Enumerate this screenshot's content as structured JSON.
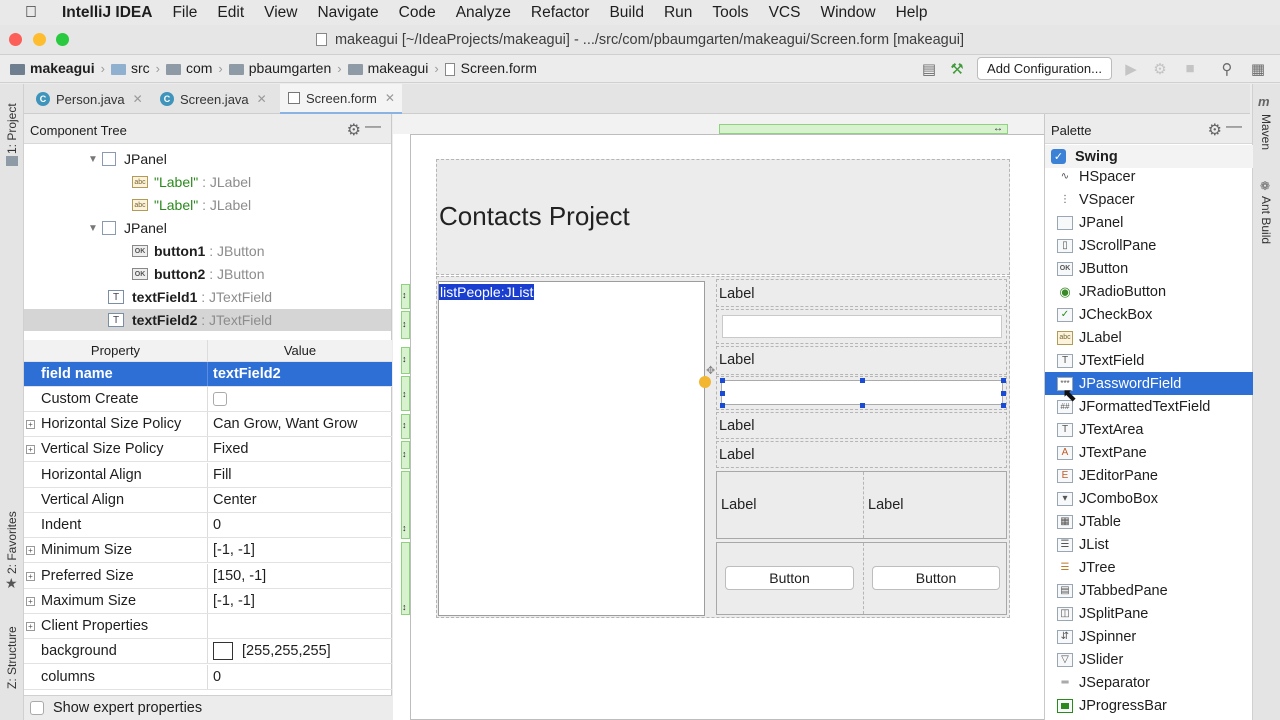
{
  "menubar": {
    "app": "IntelliJ IDEA",
    "items": [
      "File",
      "Edit",
      "View",
      "Navigate",
      "Code",
      "Analyze",
      "Refactor",
      "Build",
      "Run",
      "Tools",
      "VCS",
      "Window",
      "Help"
    ]
  },
  "window": {
    "title": "makeagui [~/IdeaProjects/makeagui] - .../src/com/pbaumgarten/makeagui/Screen.form [makeagui]"
  },
  "breadcrumbs": [
    "makeagui",
    "src",
    "com",
    "pbaumgarten",
    "makeagui",
    "Screen.form"
  ],
  "toolbar": {
    "add_configuration": "Add Configuration..."
  },
  "tabs": [
    {
      "label": "Person.java",
      "icon": "C"
    },
    {
      "label": "Screen.java",
      "icon": "C"
    },
    {
      "label": "Screen.form",
      "icon": "form"
    }
  ],
  "left_strip": {
    "project": "1: Project",
    "favorites": "2: Favorites",
    "structure": "Z: Structure"
  },
  "right_strip": {
    "maven": "Maven",
    "ant": "Ant Build"
  },
  "component_tree": {
    "title": "Component Tree",
    "rows": [
      {
        "kind": "panel",
        "name": "JPanel"
      },
      {
        "kind": "label",
        "text": "\"Label\"",
        "type": ": JLabel"
      },
      {
        "kind": "label",
        "text": "\"Label\"",
        "type": ": JLabel"
      },
      {
        "kind": "panel",
        "name": "JPanel"
      },
      {
        "kind": "button",
        "text": "button1",
        "type": ": JButton"
      },
      {
        "kind": "button",
        "text": "button2",
        "type": ": JButton"
      },
      {
        "kind": "field",
        "text": "textField1",
        "type": ": JTextField"
      },
      {
        "kind": "field",
        "text": "textField2",
        "type": ": JTextField"
      }
    ]
  },
  "properties": {
    "header_property": "Property",
    "header_value": "Value",
    "rows": [
      {
        "name": "field name",
        "value": "textField2"
      },
      {
        "name": "Custom Create",
        "value": ""
      },
      {
        "name": "Horizontal Size Policy",
        "value": "Can Grow, Want Grow"
      },
      {
        "name": "Vertical Size Policy",
        "value": "Fixed"
      },
      {
        "name": "Horizontal Align",
        "value": "Fill"
      },
      {
        "name": "Vertical Align",
        "value": "Center"
      },
      {
        "name": "Indent",
        "value": "0"
      },
      {
        "name": "Minimum Size",
        "value": "[-1, -1]"
      },
      {
        "name": "Preferred Size",
        "value": "[150, -1]"
      },
      {
        "name": "Maximum Size",
        "value": "[-1, -1]"
      },
      {
        "name": "Client Properties",
        "value": ""
      },
      {
        "name": "background",
        "value": "[255,255,255]"
      },
      {
        "name": "columns",
        "value": "0"
      }
    ],
    "show_expert": "Show expert properties"
  },
  "form": {
    "heading": "Contacts Project",
    "list_label": "listPeople:JList",
    "label": "Label",
    "button": "Button"
  },
  "palette": {
    "title": "Palette",
    "group": "Swing",
    "items": [
      "HSpacer",
      "VSpacer",
      "JPanel",
      "JScrollPane",
      "JButton",
      "JRadioButton",
      "JCheckBox",
      "JLabel",
      "JTextField",
      "JPasswordField",
      "JFormattedTextField",
      "JTextArea",
      "JTextPane",
      "JEditorPane",
      "JComboBox",
      "JTable",
      "JList",
      "JTree",
      "JTabbedPane",
      "JSplitPane",
      "JSpinner",
      "JSlider",
      "JSeparator",
      "JProgressBar"
    ],
    "selected": "JPasswordField"
  },
  "colors": {
    "selection": "#2e6fd6",
    "accent_green": "#2a8a1c"
  }
}
